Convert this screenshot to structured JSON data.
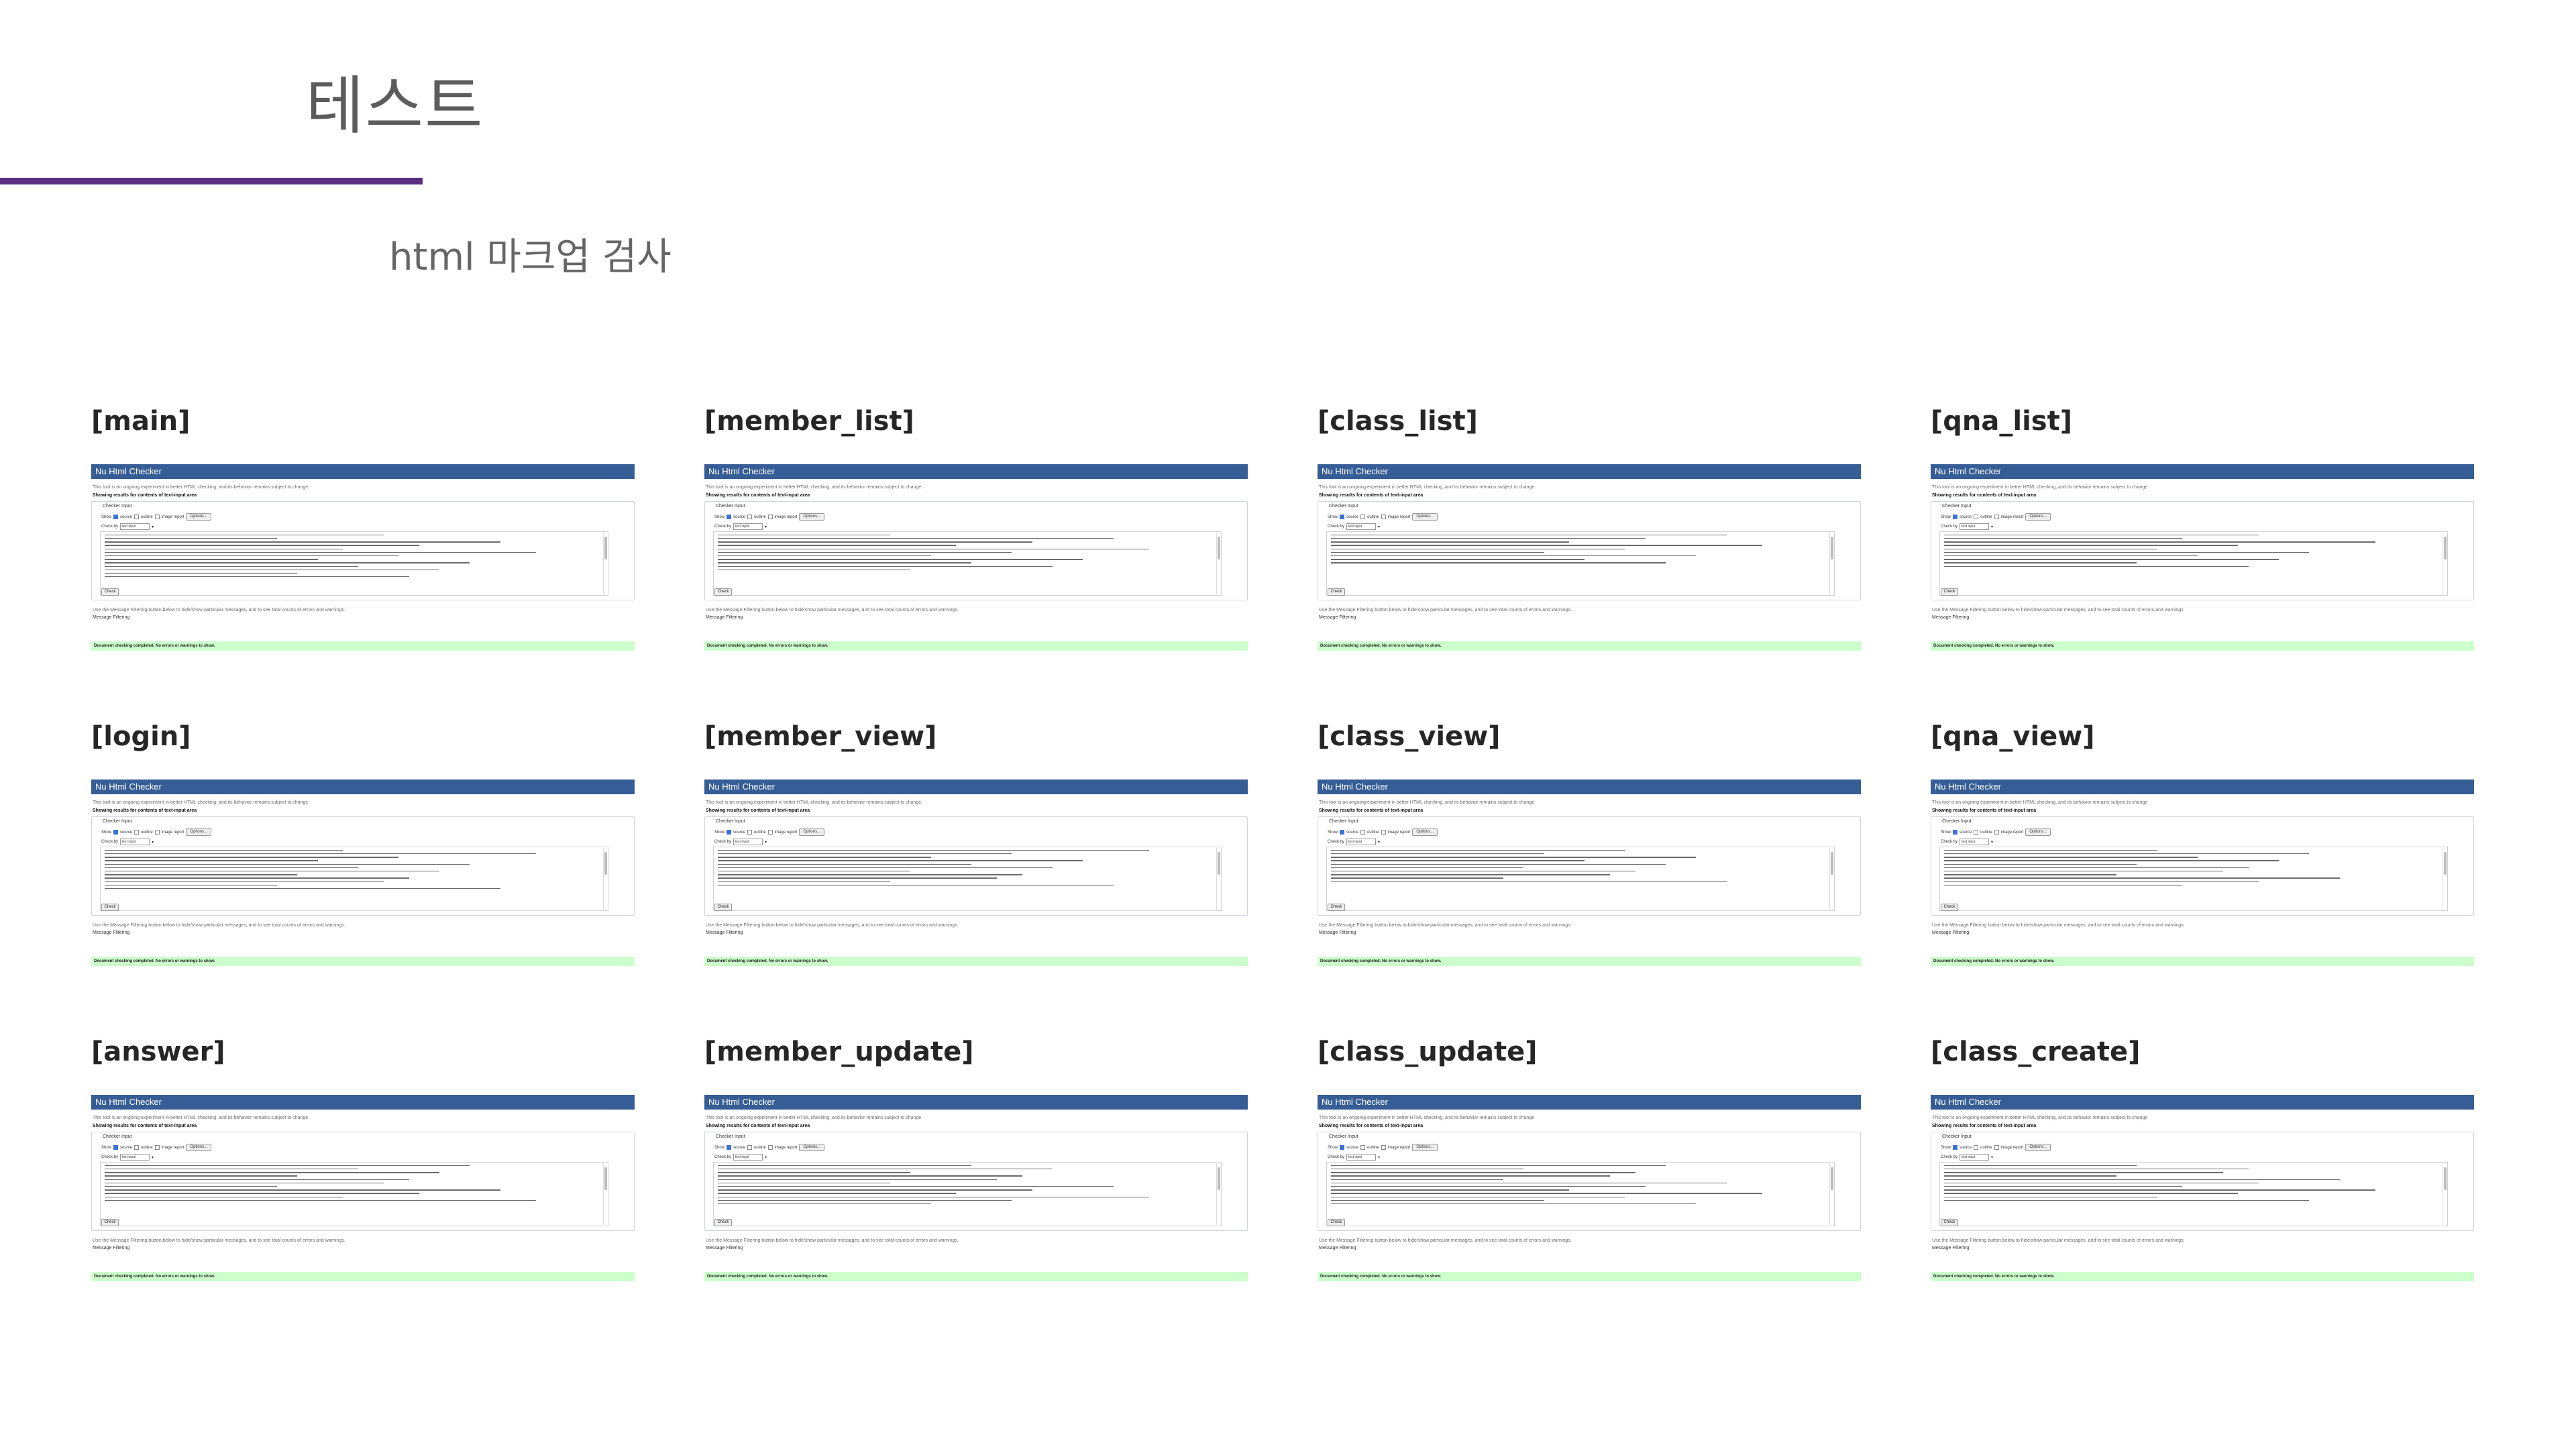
{
  "slide": {
    "title": "테스트",
    "subtitle": "html 마크업 검사"
  },
  "checker": {
    "header": "Nu Html Checker",
    "description": "This tool is an ongoing experiment in better HTML checking, and its behavior remains subject to change",
    "showing": "Showing results for contents of text-input area",
    "legend": "Checker Input",
    "show_label": "Show",
    "show_options": [
      "source",
      "outline",
      "image report"
    ],
    "options_button": "Options...",
    "check_by_label": "Check by",
    "check_by_value": "text input",
    "check_button": "Check",
    "filter_note": "Use the Message Filtering button below to hide/show particular messages, and to see total counts of errors and warnings.",
    "filter_title": "Message Filtering",
    "success": "Document checking completed. No errors or warnings to show."
  },
  "pages": [
    {
      "label": "[main]",
      "lines": 13
    },
    {
      "label": "[member_list]",
      "lines": 11
    },
    {
      "label": "[class_list]",
      "lines": 9
    },
    {
      "label": "[qna_list]",
      "lines": 10
    },
    {
      "label": "[login]",
      "lines": 12
    },
    {
      "label": "[member_view]",
      "lines": 11
    },
    {
      "label": "[class_view]",
      "lines": 10
    },
    {
      "label": "[qna_view]",
      "lines": 11
    },
    {
      "label": "[answer]",
      "lines": 11
    },
    {
      "label": "[member_update]",
      "lines": 12
    },
    {
      "label": "[class_update]",
      "lines": 12
    },
    {
      "label": "[class_create]",
      "lines": 11
    }
  ]
}
